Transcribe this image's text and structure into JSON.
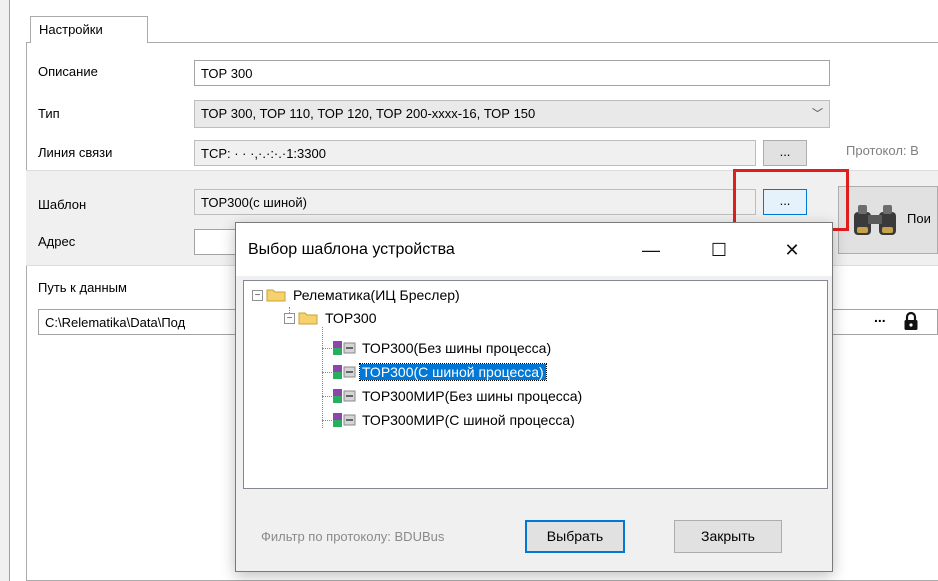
{
  "tab": {
    "label": "Настройки"
  },
  "form": {
    "description": {
      "label": "Описание",
      "value": "ТОР 300"
    },
    "type": {
      "label": "Тип",
      "value": "ТОР 300, ТОР 110, ТОР 120, ТОР 200-xxxx-16, ТОР 150"
    },
    "line": {
      "label": "Линия связи",
      "value": "TCP: ·  · ·,·.·:·.·1:3300",
      "button": "...",
      "protocol_label": "Протокол: B"
    },
    "template": {
      "label": "Шаблон",
      "value": "ТОР300(с шиной)",
      "button": "..."
    },
    "address": {
      "label": "Адрес",
      "value": ""
    },
    "search": {
      "label": "Пои"
    },
    "data_path": {
      "label": "Путь к данным",
      "value": "C:\\Relematika\\Data\\Под",
      "button": "..."
    }
  },
  "dialog": {
    "title": "Выбор шаблона устройства",
    "controls": {
      "minimize": "—",
      "maximize": "☐",
      "close": "✕"
    },
    "tree": {
      "root": {
        "label": "Релематика(ИЦ Бреслер)",
        "expander": "−"
      },
      "group": {
        "label": "ТОР300",
        "expander": "−"
      },
      "items": [
        {
          "label": "ТОР300(Без шины процесса)",
          "selected": false
        },
        {
          "label": "ТОР300(С шиной процесса)",
          "selected": true
        },
        {
          "label": "ТОР300МИР(Без шины процесса)",
          "selected": false
        },
        {
          "label": "ТОР300МИР(С шиной процесса)",
          "selected": false
        }
      ]
    },
    "filter_label": "Фильтр по протоколу: BDUBus",
    "select_button": "Выбрать",
    "close_button": "Закрыть"
  },
  "colors": {
    "selection": "#0078d7",
    "highlight_box": "#e11d1d"
  }
}
